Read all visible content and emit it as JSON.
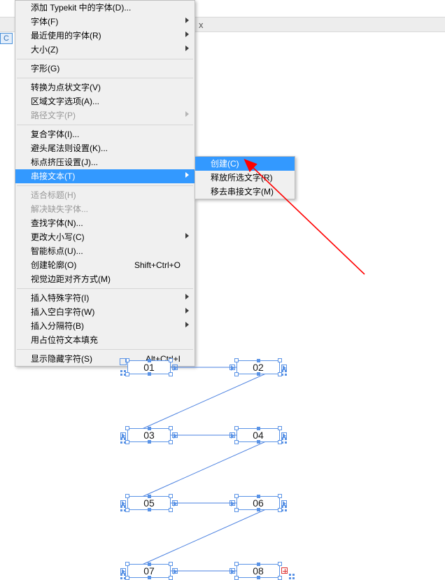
{
  "toolbar": {
    "close_x": "x",
    "tab_c": "C"
  },
  "menu": {
    "add_typekit": "添加 Typekit 中的字体(D)...",
    "font": "字体(F)",
    "recent_fonts": "最近使用的字体(R)",
    "size": "大小(Z)",
    "glyphs": "字形(G)",
    "to_point_text": "转换为点状文字(V)",
    "area_type_opts": "区域文字选项(A)...",
    "type_on_path": "路径文字(P)",
    "composite_fonts": "复合字体(I)...",
    "kinsoku": "避头尾法则设置(K)...",
    "mojikumi": "标点挤压设置(J)...",
    "threaded_text": "串接文本(T)",
    "fit_headline": "适合标题(H)",
    "resolve_missing": "解决缺失字体...",
    "find_font": "查找字体(N)...",
    "change_case": "更改大小写(C)",
    "smart_punct": "智能标点(U)...",
    "create_outlines": "创建轮廓(O)",
    "create_outlines_sc": "Shift+Ctrl+O",
    "optical_margin": "视觉边距对齐方式(M)",
    "insert_special": "插入特殊字符(I)",
    "insert_whitespace": "插入空白字符(W)",
    "insert_break": "插入分隔符(B)",
    "fill_placeholder": "用占位符文本填充",
    "show_hidden": "显示隐藏字符(S)",
    "show_hidden_sc": "Alt+Ctrl+I"
  },
  "submenu": {
    "create": "创建(C)",
    "release": "释放所选文字(R)",
    "remove": "移去串接文字(M)"
  },
  "boxes": {
    "b1": "01",
    "b2": "02",
    "b3": "03",
    "b4": "04",
    "b5": "05",
    "b6": "06",
    "b7": "07",
    "b8": "08"
  }
}
